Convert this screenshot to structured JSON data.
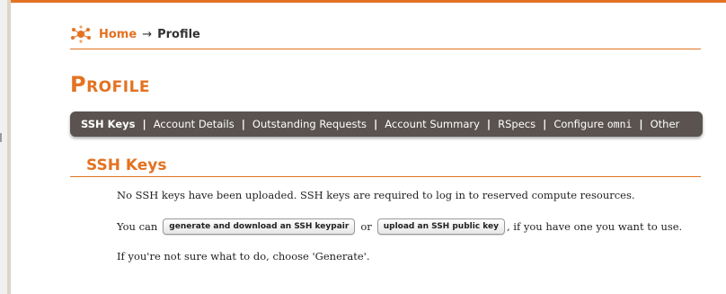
{
  "breadcrumb": {
    "home": "Home",
    "arrow": "→",
    "current": "Profile"
  },
  "page": {
    "title": "Profile"
  },
  "tabs": [
    {
      "label": "SSH Keys",
      "active": true
    },
    {
      "label": "Account Details",
      "active": false
    },
    {
      "label": "Outstanding Requests",
      "active": false
    },
    {
      "label": "Account Summary",
      "active": false
    },
    {
      "label": "RSpecs",
      "active": false
    },
    {
      "label_prefix": "Configure",
      "label_code": "omni",
      "active": false
    },
    {
      "label": "Other",
      "active": false
    }
  ],
  "tab_separator": "|",
  "section": {
    "title": "SSH Keys",
    "message1": "No SSH keys have been uploaded. SSH keys are required to log in to reserved compute resources.",
    "message2_prefix": "You can",
    "generate_button": "generate and download an SSH keypair",
    "or": "or",
    "upload_button": "upload an SSH public key",
    "message2_suffix": ", if you have one you want to use.",
    "message3": "If you're not sure what to do, choose 'Generate'."
  },
  "icons": {
    "logo": "geni-logo-icon"
  },
  "colors": {
    "accent": "#e37222",
    "tabbar": "#5a5350"
  }
}
